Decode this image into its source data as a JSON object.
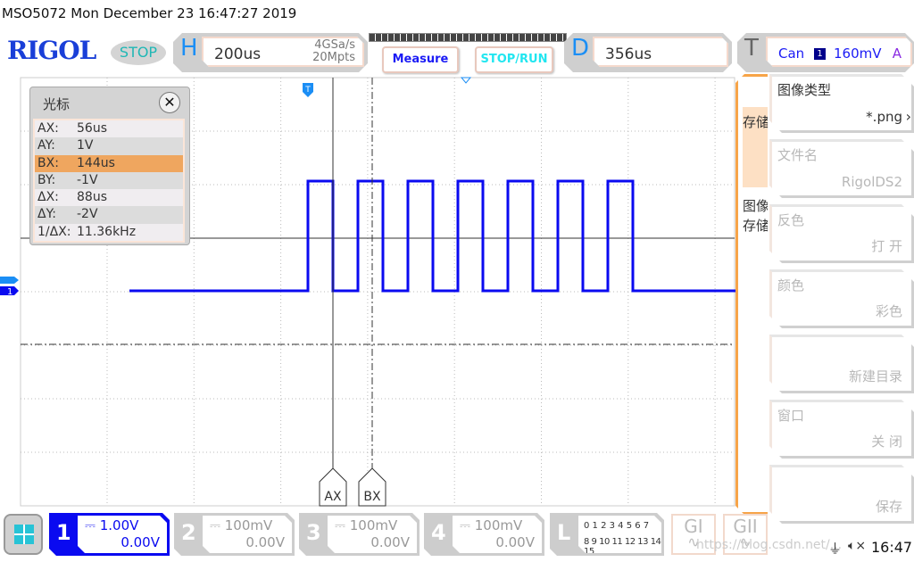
{
  "title": "MSO5072  Mon December 23 16:47:27 2019",
  "logo": "RIGOL",
  "run_state": "STOP",
  "horizontal": {
    "letter": "H",
    "timebase": "200us",
    "sample_rate": "4GSa/s",
    "memory": "20Mpts"
  },
  "buttons": {
    "measure": "Measure",
    "stop_run": "STOP/RUN"
  },
  "delay": {
    "letter": "D",
    "value": "356us"
  },
  "trigger": {
    "letter": "T",
    "type": "Can",
    "source": "1",
    "level": "160mV",
    "mode": "A"
  },
  "cursor_panel": {
    "title": "光标",
    "close": "✕",
    "rows": [
      {
        "k": "AX:",
        "v": "56us"
      },
      {
        "k": "AY:",
        "v": "1V"
      },
      {
        "k": "BX:",
        "v": "144us",
        "selected": true
      },
      {
        "k": "BY:",
        "v": "-1V"
      },
      {
        "k": "ΔX:",
        "v": "88us"
      },
      {
        "k": "ΔY:",
        "v": "-2V"
      },
      {
        "k": "1/ΔX:",
        "v": "11.36kHz"
      }
    ]
  },
  "cursor_labels": {
    "a": "AX",
    "b": "BX"
  },
  "markers": {
    "trigger": "T",
    "channel": "1",
    "trig_level": "T"
  },
  "side_menu": {
    "tab1": "存储",
    "tab2": "图像存储",
    "items": [
      {
        "title": "图像类型",
        "value": "*.png",
        "enabled": true
      },
      {
        "title": "文件名",
        "value": "RigolDS2",
        "enabled": false
      },
      {
        "title": "反色",
        "value": "打 开",
        "enabled": false
      },
      {
        "title": "颜色",
        "value": "彩色",
        "enabled": false
      },
      {
        "title": "",
        "value": "新建目录",
        "enabled": false
      },
      {
        "title": "窗口",
        "value": "关 闭",
        "enabled": false
      },
      {
        "title": "",
        "value": "保存",
        "enabled": false
      }
    ]
  },
  "channels": [
    {
      "n": "1",
      "scale": "1.00V",
      "offset": "0.00V",
      "active": true
    },
    {
      "n": "2",
      "scale": "100mV",
      "offset": "0.00V",
      "active": false
    },
    {
      "n": "3",
      "scale": "100mV",
      "offset": "0.00V",
      "active": false
    },
    {
      "n": "4",
      "scale": "100mV",
      "offset": "0.00V",
      "active": false
    }
  ],
  "logic": {
    "letter": "L",
    "row1": "0 1 2 3   4 5 6 7",
    "row2": "8 9 10 11 12 13 14 15"
  },
  "generators": [
    "GI",
    "GII"
  ],
  "watermark": "https://blog.csdn.net/...",
  "status": {
    "time": "16:47",
    "usb": "usb-icon",
    "sound": "mute-icon"
  },
  "colors": {
    "ch1": "#0a0af0",
    "accent": "#f7a448",
    "logo": "#1a3fd8"
  },
  "waveform": {
    "channel": "1",
    "low_v": -1,
    "high_v": 1,
    "edges_us": [
      56,
      100,
      144,
      188,
      232,
      276,
      320,
      364,
      408,
      452,
      496,
      540,
      584,
      628
    ]
  }
}
